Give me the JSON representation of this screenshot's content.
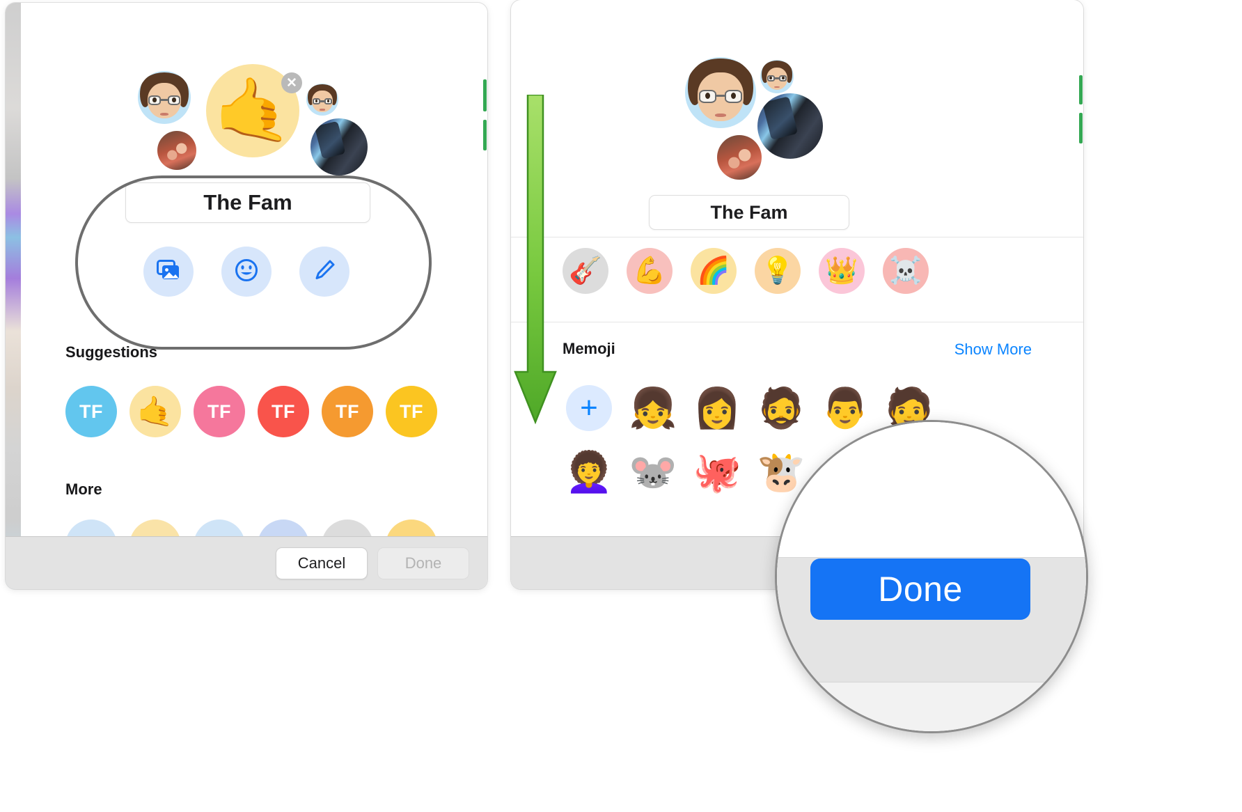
{
  "meta": {
    "app": "Messages Group Photo Picker",
    "accent_blue": "#0a84ff",
    "done_button_blue": "#1574f5",
    "arrow_green": "#5cb531"
  },
  "left_panel": {
    "group_name_value": "The Fam",
    "close_badge": "✕",
    "avatars": [
      {
        "name": "memoji-avatar-main",
        "kind": "memoji"
      },
      {
        "name": "emoji-avatar-selected",
        "kind": "emoji",
        "glyph": "🤙",
        "bg": "#fbe3a0"
      },
      {
        "name": "memoji-avatar-small",
        "kind": "memoji"
      },
      {
        "name": "photo-avatar-kids",
        "kind": "photo"
      },
      {
        "name": "photo-avatar-selfie",
        "kind": "photo"
      }
    ],
    "actions": [
      {
        "name": "photos-button",
        "icon": "photos-icon"
      },
      {
        "name": "emoji-button",
        "icon": "smiley-icon"
      },
      {
        "name": "draw-button",
        "icon": "pencil-icon"
      }
    ],
    "suggestions_label": "Suggestions",
    "suggestions": [
      {
        "label": "TF",
        "bg": "#62c6ee",
        "emoji": null
      },
      {
        "label": "",
        "bg": "#fbe3a0",
        "emoji": "🤙"
      },
      {
        "label": "TF",
        "bg": "#f5779c",
        "emoji": null
      },
      {
        "label": "TF",
        "bg": "#f9544b",
        "emoji": null
      },
      {
        "label": "TF",
        "bg": "#f59a30",
        "emoji": null
      },
      {
        "label": "TF",
        "bg": "#fbc521",
        "emoji": null
      }
    ],
    "more_label": "More",
    "more_row": [
      {
        "bg": "#cfe4f7"
      },
      {
        "bg": "#fae3a8"
      },
      {
        "bg": "#cfe4f7"
      },
      {
        "bg": "#c8d8f5"
      },
      {
        "bg": "#dcdcdc"
      },
      {
        "bg": "#fbd87e"
      }
    ],
    "footer": {
      "cancel_label": "Cancel",
      "done_label": "Done",
      "done_enabled": false
    }
  },
  "right_panel": {
    "group_name_value": "The Fam",
    "emoji_row": [
      {
        "glyph": "🎸",
        "bg": "#dcdcdc",
        "name": "guitar-emoji"
      },
      {
        "glyph": "💪",
        "bg": "#f8c0bd",
        "name": "flexed-biceps-emoji"
      },
      {
        "glyph": "🌈",
        "bg": "#fbe3a0",
        "name": "rainbow-emoji"
      },
      {
        "glyph": "💡",
        "bg": "#fbd6a3",
        "name": "light-bulb-emoji"
      },
      {
        "glyph": "👑",
        "bg": "#fbc6d8",
        "name": "crown-emoji"
      },
      {
        "glyph": "☠️",
        "bg": "#f8b7b4",
        "name": "skull-crossbones-emoji"
      }
    ],
    "memoji_label": "Memoji",
    "show_more_label": "Show More",
    "memoji_items": [
      {
        "glyph": "+",
        "name": "add-memoji-button",
        "is_add": true
      },
      {
        "glyph": "👧",
        "name": "memoji-face-1"
      },
      {
        "glyph": "👩",
        "name": "memoji-face-2"
      },
      {
        "glyph": "🧔",
        "name": "memoji-face-3"
      },
      {
        "glyph": "👨",
        "name": "memoji-face-4"
      },
      {
        "glyph": "🧑",
        "name": "memoji-face-5"
      },
      {
        "glyph": "👩‍🦱",
        "name": "memoji-face-6"
      },
      {
        "glyph": "🐭",
        "name": "memoji-mouse"
      },
      {
        "glyph": "🐙",
        "name": "memoji-octopus"
      },
      {
        "glyph": "🐮",
        "name": "memoji-cow"
      }
    ]
  },
  "magnifier": {
    "done_label": "Done"
  }
}
